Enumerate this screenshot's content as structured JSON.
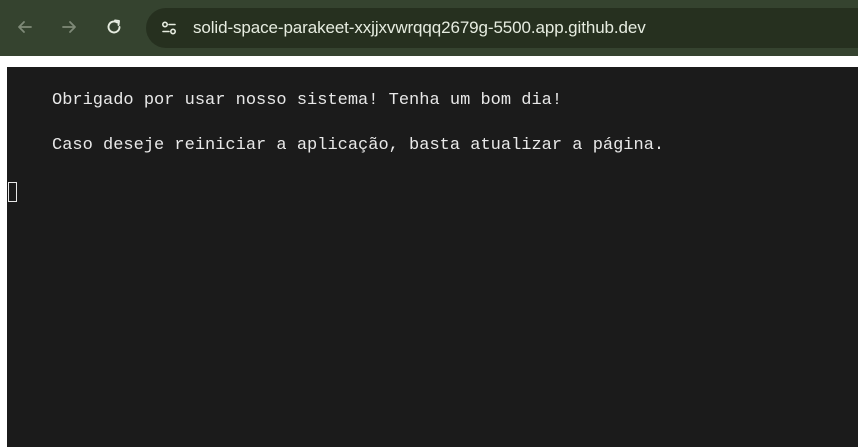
{
  "browser": {
    "url": "solid-space-parakeet-xxjjxvwrqqq2679g-5500.app.github.dev",
    "icons": {
      "back": "arrow-left-icon",
      "forward": "arrow-right-icon",
      "reload": "reload-icon",
      "site_info": "tune-icon"
    }
  },
  "terminal": {
    "lines": [
      "Obrigado por usar nosso sistema! Tenha um bom dia!",
      "Caso deseje reiniciar a aplicação, basta atualizar a página."
    ]
  },
  "colors": {
    "toolbar": "#35432f",
    "omnibox": "#26301f",
    "terminal_bg": "#1b1b1b",
    "terminal_text": "#e8e8e8"
  }
}
